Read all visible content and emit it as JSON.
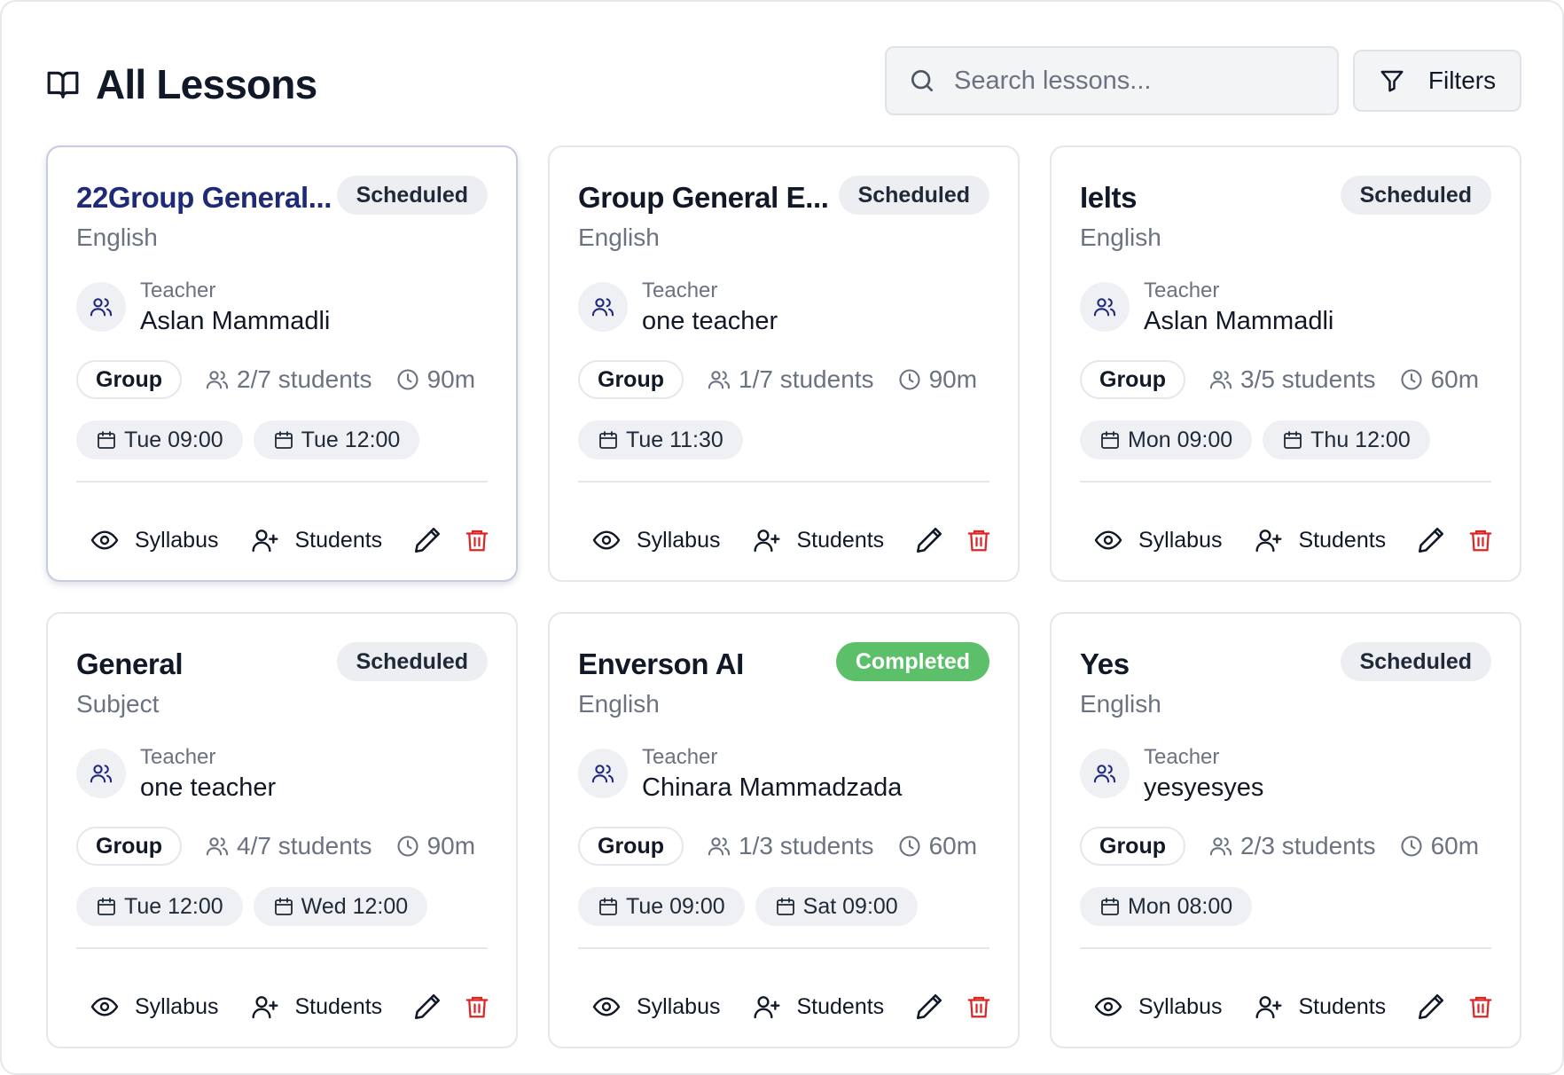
{
  "header": {
    "title": "All Lessons",
    "search_placeholder": "Search lessons...",
    "filters_label": "Filters"
  },
  "labels": {
    "teacher": "Teacher",
    "syllabus": "Syllabus",
    "students": "Students"
  },
  "colors": {
    "accent_title": "#1e2a78",
    "completed_badge": "#5cbf6a",
    "delete_red": "#dc2626"
  },
  "lessons": [
    {
      "title": "22Group General...",
      "subject": "English",
      "status": "Scheduled",
      "teacher": "Aslan Mammadli",
      "type": "Group",
      "students": "2/7 students",
      "duration": "90m",
      "times": [
        "Tue 09:00",
        "Tue 12:00"
      ]
    },
    {
      "title": "Group General E...",
      "subject": "English",
      "status": "Scheduled",
      "teacher": "one teacher",
      "type": "Group",
      "students": "1/7 students",
      "duration": "90m",
      "times": [
        "Tue 11:30"
      ]
    },
    {
      "title": "Ielts",
      "subject": "English",
      "status": "Scheduled",
      "teacher": "Aslan Mammadli",
      "type": "Group",
      "students": "3/5 students",
      "duration": "60m",
      "times": [
        "Mon 09:00",
        "Thu 12:00"
      ]
    },
    {
      "title": "General",
      "subject": "Subject",
      "status": "Scheduled",
      "teacher": "one teacher",
      "type": "Group",
      "students": "4/7 students",
      "duration": "90m",
      "times": [
        "Tue 12:00",
        "Wed 12:00"
      ]
    },
    {
      "title": "Enverson AI",
      "subject": "English",
      "status": "Completed",
      "teacher": "Chinara Mammadzada",
      "type": "Group",
      "students": "1/3 students",
      "duration": "60m",
      "times": [
        "Tue 09:00",
        "Sat 09:00"
      ]
    },
    {
      "title": "Yes",
      "subject": "English",
      "status": "Scheduled",
      "teacher": "yesyesyes",
      "type": "Group",
      "students": "2/3 students",
      "duration": "60m",
      "times": [
        "Mon 08:00"
      ]
    }
  ]
}
